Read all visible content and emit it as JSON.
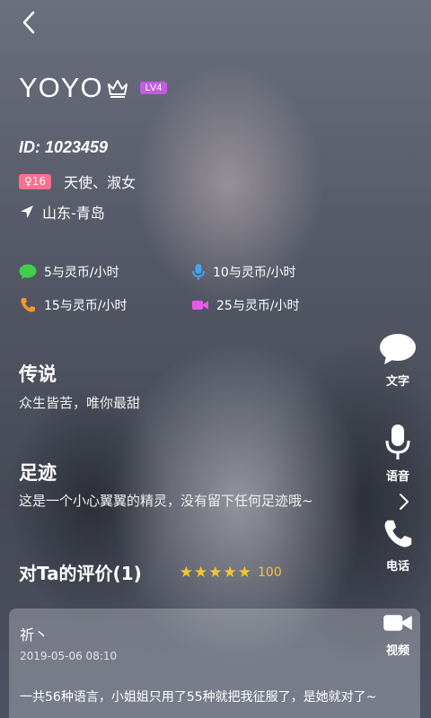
{
  "profile": {
    "name": "YOYO",
    "level": "LV4",
    "id": "ID: 1023459",
    "gender_age": "♀16",
    "tags": "天使、淑女",
    "location": "山东-青岛"
  },
  "prices": {
    "text": "5与灵币/小时",
    "voice": "10与灵币/小时",
    "phone": "15与灵币/小时",
    "video": "25与灵币/小时"
  },
  "legend": {
    "title": "传说",
    "text": "众生皆苦，唯你最甜"
  },
  "footprint": {
    "title": "足迹",
    "text": "这是一个小心翼翼的精灵，没有留下任何足迹哦~"
  },
  "rating": {
    "title": "对Ta的评价(1)",
    "stars": 5,
    "score": "100"
  },
  "actions": {
    "text": "文字",
    "voice": "语音",
    "phone": "电话",
    "video": "视频"
  },
  "review": {
    "user": "祈丶",
    "date": "2019-05-06 08:10",
    "text": "一共56种语言，小姐姐只用了55种就把我征服了，是她就对了~"
  },
  "colors": {
    "level_badge": "#c65ae6",
    "gender_badge": "#ff6f8f",
    "star": "#f7c52f",
    "chat_icon": "#3fcf4d",
    "mic_icon": "#3fa8f0",
    "phone_icon": "#f39a2a",
    "video_icon": "#e85ae6"
  }
}
